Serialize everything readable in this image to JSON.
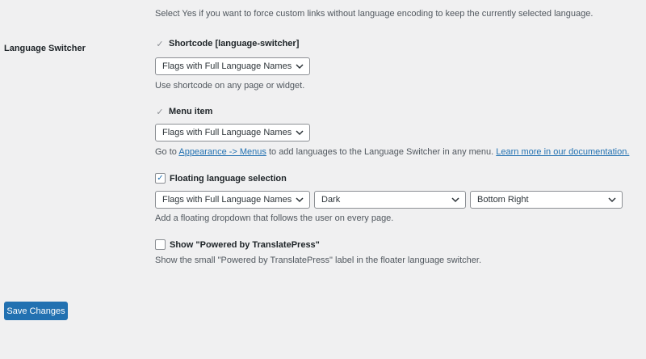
{
  "top_description": "Select Yes if you want to force custom links without language encoding to keep the currently selected language.",
  "section": {
    "label": "Language Switcher"
  },
  "shortcode": {
    "label": "Shortcode [language-switcher]",
    "checked": true,
    "select_value": "Flags with Full Language Names",
    "description": "Use shortcode on any page or widget."
  },
  "menu_item": {
    "label": "Menu item",
    "checked": true,
    "select_value": "Flags with Full Language Names",
    "description_before": "Go to ",
    "link_appearance": "Appearance -> Menus",
    "description_middle": " to add languages to the Language Switcher in any menu. ",
    "link_docs": "Learn more in our documentation."
  },
  "floating": {
    "label": "Floating language selection",
    "checked": true,
    "select_style": "Flags with Full Language Names",
    "select_theme": "Dark",
    "select_position": "Bottom Right",
    "description": "Add a floating dropdown that follows the user on every page."
  },
  "powered_by": {
    "label": "Show \"Powered by TranslatePress\"",
    "checked": false,
    "description": "Show the small \"Powered by TranslatePress\" label in the floater language switcher."
  },
  "save_button": "Save Changes",
  "icons": {
    "check": "checkmark-icon",
    "dropdown": "chevron-down-icon"
  },
  "colors": {
    "accent": "#2271b1",
    "background": "#f0f0f1"
  }
}
